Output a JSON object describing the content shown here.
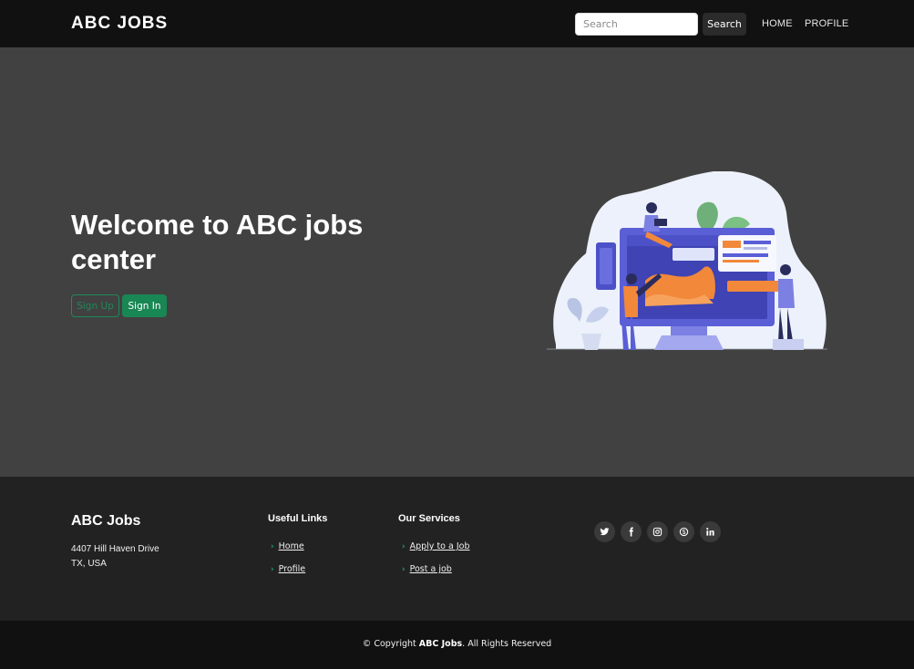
{
  "header": {
    "brand": "ABC JOBS",
    "search_placeholder": "Search",
    "search_button": "Search",
    "nav": {
      "home": "HOME",
      "profile": "PROFILE"
    }
  },
  "hero": {
    "title": "Welcome to ABC jobs center",
    "signup_label": "Sign Up",
    "signin_label": "Sign In",
    "illustration_icon": "jobs-dashboard-illustration"
  },
  "footer": {
    "brand": "ABC Jobs",
    "address_line1": "4407 Hill Haven Drive",
    "address_line2": "TX, USA",
    "useful_links": {
      "title": "Useful Links",
      "items": [
        {
          "label": "Home"
        },
        {
          "label": "Profile"
        }
      ]
    },
    "services": {
      "title": "Our Services",
      "items": [
        {
          "label": "Apply to a Job"
        },
        {
          "label": "Post a job"
        }
      ]
    },
    "socials": [
      "twitter-icon",
      "facebook-icon",
      "instagram-icon",
      "skype-icon",
      "linkedin-icon"
    ]
  },
  "copyright": {
    "prefix": "© Copyright ",
    "brand": "ABC Jobs",
    "suffix": ". All Rights Reserved"
  },
  "colors": {
    "topbar": "#111111",
    "hero_bg": "#414141",
    "footer_bg": "#222222",
    "accent_green": "#198754",
    "illustration_orange": "#f2883a",
    "illustration_purple": "#5a5fd6"
  }
}
